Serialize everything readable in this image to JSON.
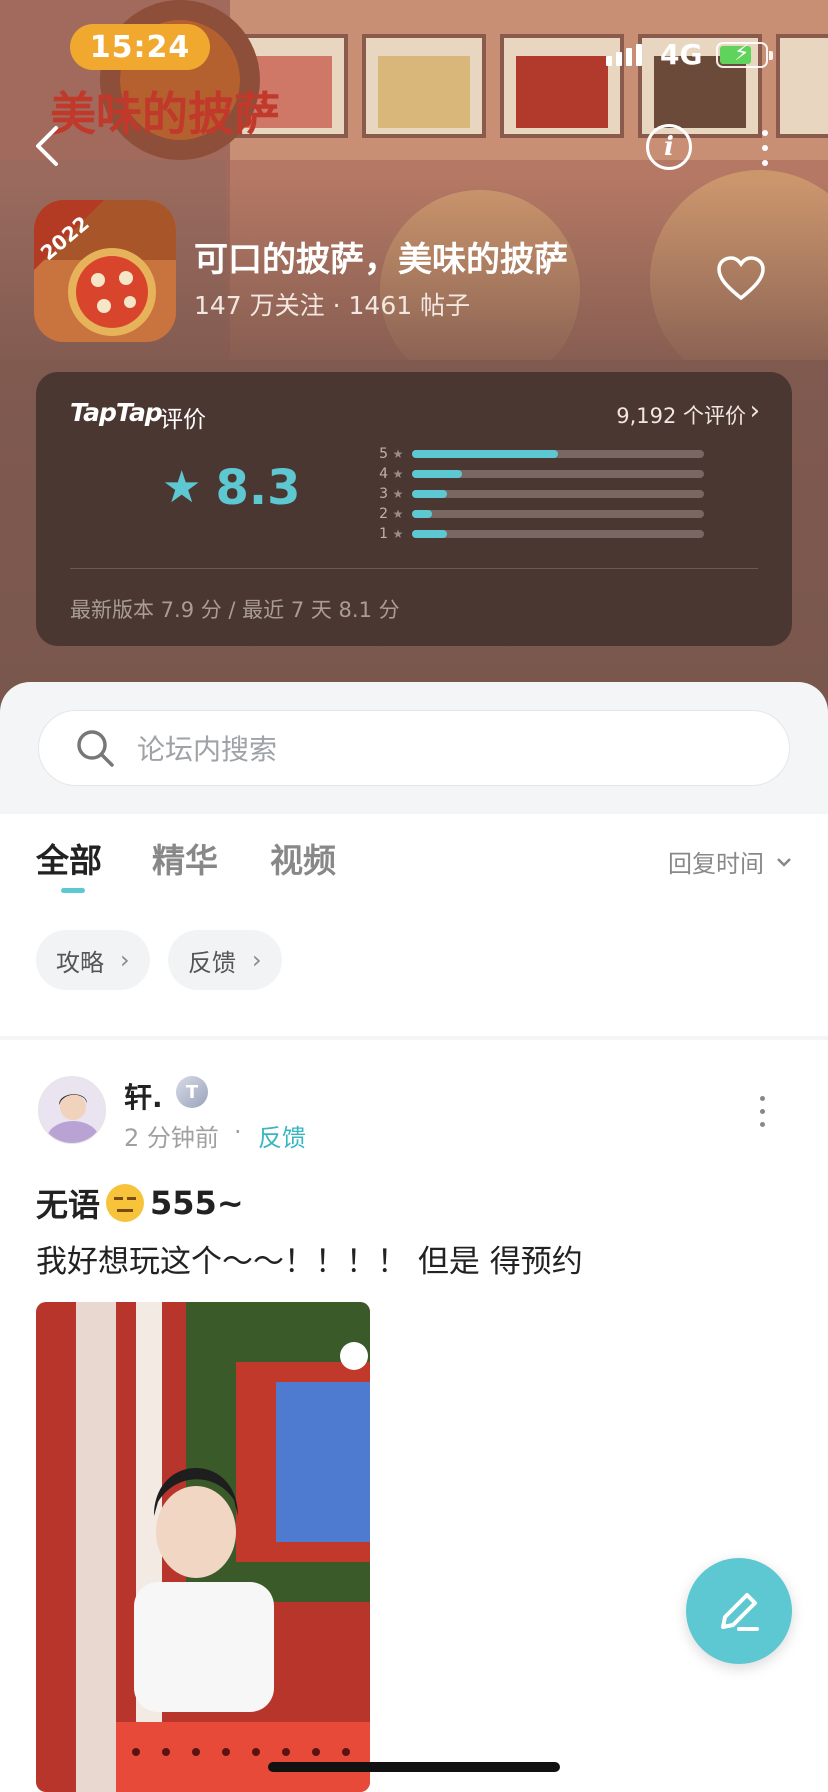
{
  "status_bar": {
    "time": "15:24",
    "network": "4G"
  },
  "header": {
    "back_icon": "chevron-left-icon",
    "info_icon": "info-icon",
    "more_icon": "more-vertical-icon"
  },
  "game": {
    "title": "可口的披萨，美味的披萨",
    "meta": "147 万关注 · 1461 帖子",
    "icon_badge": "2022",
    "banner_text": "美味的披萨"
  },
  "rating": {
    "logo": "TapTap",
    "label": "评价",
    "count": "9,192 个评价",
    "score": "8.3",
    "bars": [
      {
        "star": "5",
        "fraction": 0.5
      },
      {
        "star": "4",
        "fraction": 0.17
      },
      {
        "star": "3",
        "fraction": 0.12
      },
      {
        "star": "2",
        "fraction": 0.07
      },
      {
        "star": "1",
        "fraction": 0.12
      }
    ],
    "footer": "最新版本 7.9 分 / 最近 7 天 8.1 分"
  },
  "search": {
    "placeholder": "论坛内搜索"
  },
  "tabs": [
    {
      "label": "全部",
      "active": true
    },
    {
      "label": "精华",
      "active": false
    },
    {
      "label": "视频",
      "active": false
    }
  ],
  "sort_label": "回复时间",
  "chips": [
    {
      "label": "攻略"
    },
    {
      "label": "反馈"
    }
  ],
  "post": {
    "username": "轩.",
    "badge": "T",
    "time": "2 分钟前",
    "category": "反馈",
    "title_a": "无语",
    "title_b": "555~",
    "body": "我好想玩这个～～！！！！ 但是 得预约"
  },
  "colors": {
    "accent": "#5ec8d2",
    "banner": "#8f6357",
    "status_time_bg": "#f0a92e",
    "card": "#463430"
  }
}
